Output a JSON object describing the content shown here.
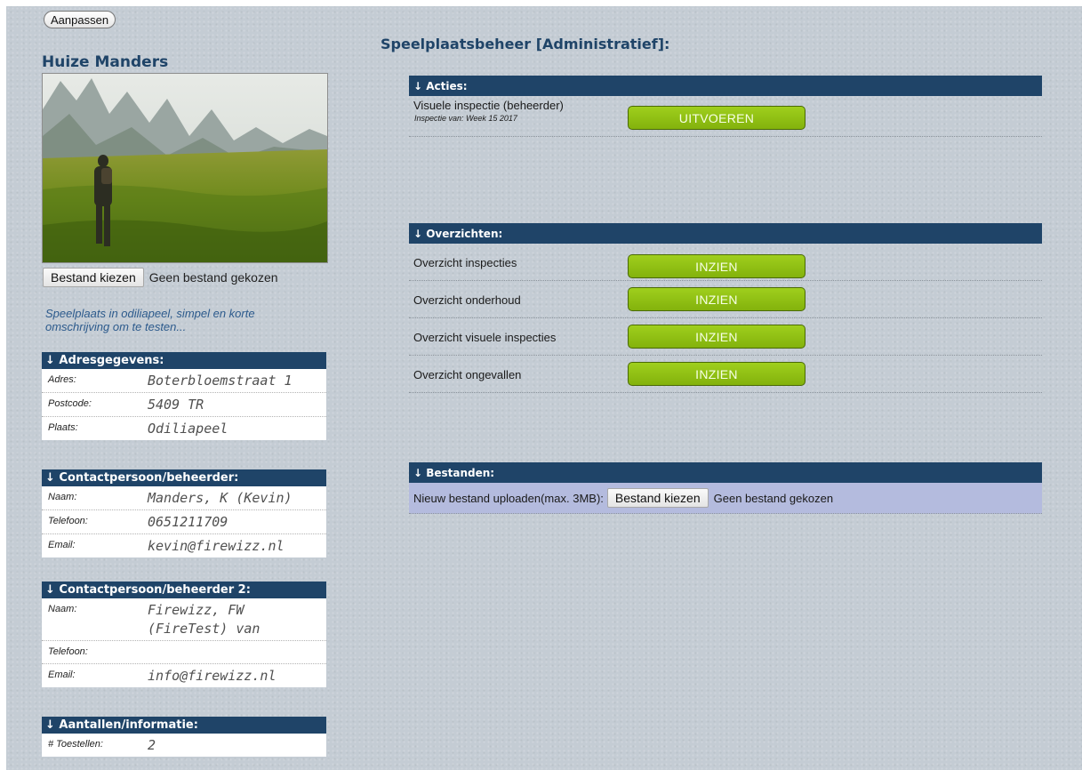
{
  "top": {
    "customize_label": "Aanpassen"
  },
  "sidebar": {
    "title": "Huize Manders",
    "photo_upload": {
      "button": "Bestand kiezen",
      "status": "Geen bestand gekozen"
    },
    "description": "Speelplaats in odiliapeel, simpel en korte omschrijving om te testen...",
    "address": {
      "header": "↓ Adresgegevens:",
      "rows": [
        {
          "label": "Adres:",
          "value": "Boterbloemstraat 1"
        },
        {
          "label": "Postcode:",
          "value": "5409 TR"
        },
        {
          "label": "Plaats:",
          "value": "Odiliapeel"
        }
      ]
    },
    "contact1": {
      "header": "↓ Contactpersoon/beheerder:",
      "rows": [
        {
          "label": "Naam:",
          "value": "Manders, K (Kevin)"
        },
        {
          "label": "Telefoon:",
          "value": "0651211709"
        },
        {
          "label": "Email:",
          "value": "kevin@firewizz.nl"
        }
      ]
    },
    "contact2": {
      "header": "↓ Contactpersoon/beheerder 2:",
      "rows": [
        {
          "label": "Naam:",
          "value": "Firewizz, FW (FireTest) van"
        },
        {
          "label": "Telefoon:",
          "value": ""
        },
        {
          "label": "Email:",
          "value": "info@firewizz.nl"
        }
      ]
    },
    "counts": {
      "header": "↓ Aantallen/informatie:",
      "rows": [
        {
          "label": "# Toestellen:",
          "value": "2"
        }
      ]
    }
  },
  "main": {
    "title": "Speelplaatsbeheer [Administratief]:",
    "acties": {
      "header": "↓ Acties:",
      "rows": [
        {
          "label": "Visuele inspectie (beheerder)",
          "sub": "Inspectie van: Week 15 2017",
          "button": "UITVOEREN"
        }
      ]
    },
    "overzichten": {
      "header": "↓ Overzichten:",
      "rows": [
        {
          "label": "Overzicht inspecties",
          "button": "INZIEN"
        },
        {
          "label": "Overzicht onderhoud",
          "button": "INZIEN"
        },
        {
          "label": "Overzicht visuele inspecties",
          "button": "INZIEN"
        },
        {
          "label": "Overzicht ongevallen",
          "button": "INZIEN"
        }
      ]
    },
    "bestanden": {
      "header": "↓ Bestanden:",
      "upload_label": "Nieuw bestand uploaden(max. 3MB):",
      "button": "Bestand kiezen",
      "status": "Geen bestand gekozen"
    }
  },
  "colors": {
    "header_bg": "#1f4468",
    "action_green": "#8fc214",
    "page_bg": "#c4ccd4",
    "upload_row_bg": "#b4bbde"
  }
}
